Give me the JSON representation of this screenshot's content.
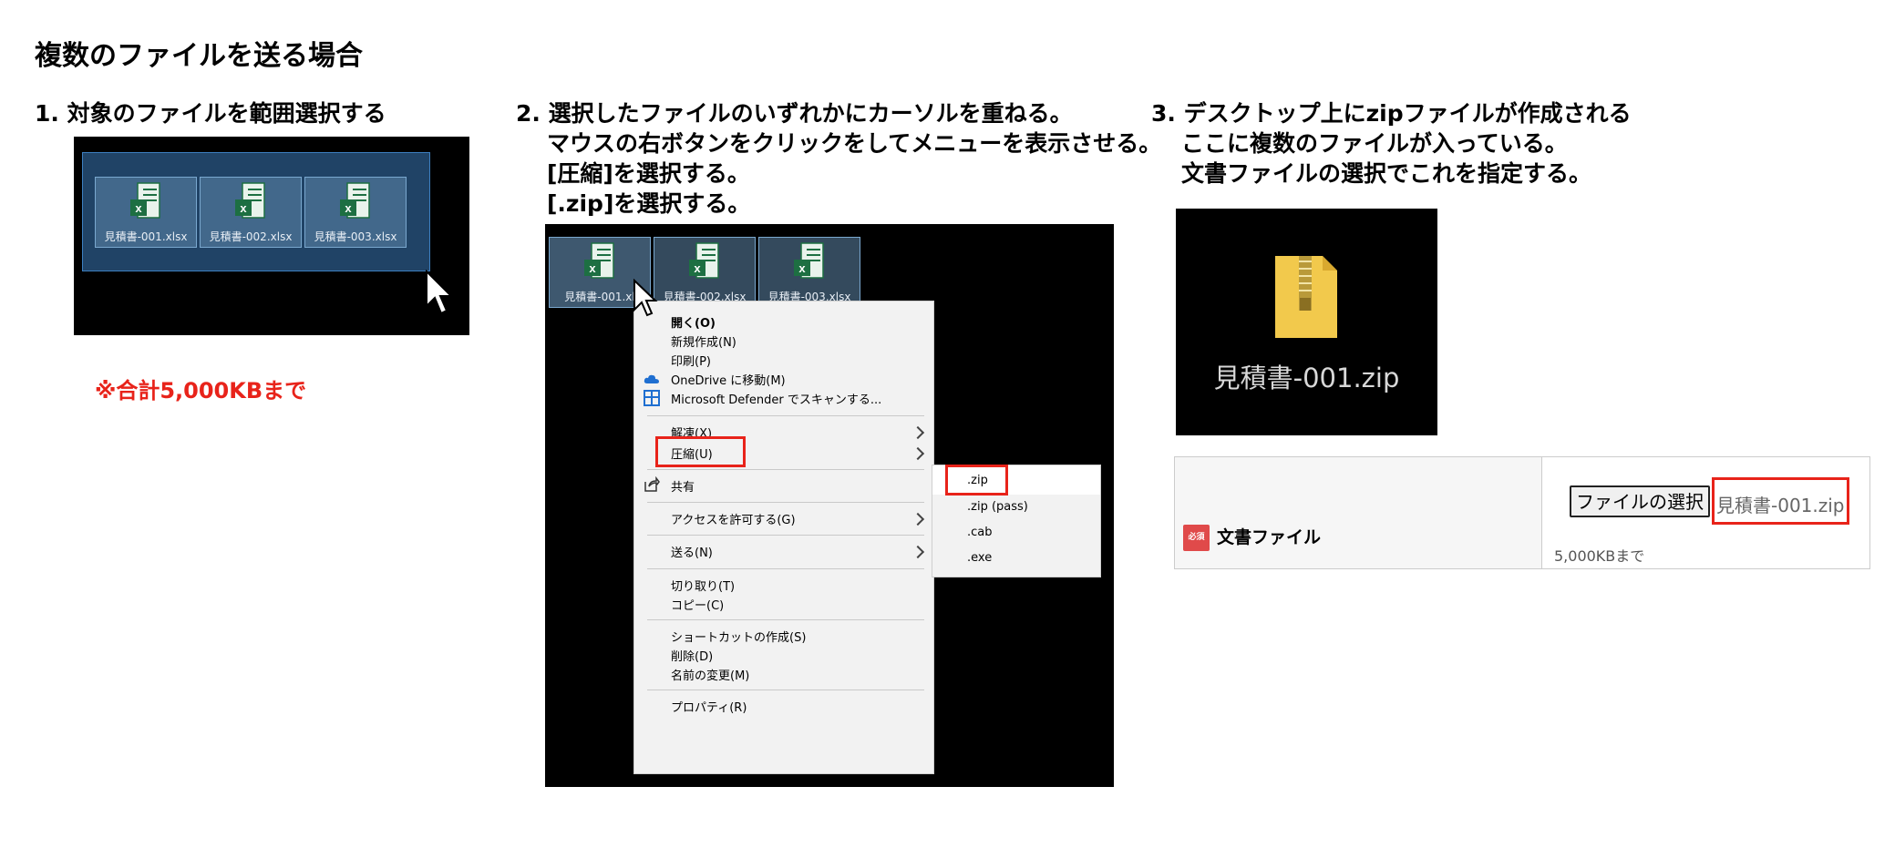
{
  "title": "複数のファイルを送る場合",
  "step1": {
    "heading": "1. 対象のファイルを範囲選択する"
  },
  "note": "※合計5,000KBまで",
  "files": [
    "見積書-001.xlsx",
    "見積書-002.xlsx",
    "見積書-003.xlsx"
  ],
  "step2": {
    "line1": "2. 選択したファイルのいずれかにカーソルを重ねる。",
    "line2": "マウスの右ボタンをクリックをしてメニューを表示させる。",
    "line3": "[圧縮]を選択する。",
    "line4": "[.zip]を選択する。"
  },
  "panel2_files": [
    "見積書-001.xl",
    "見積書-002.xlsx",
    "見積書-003.xlsx"
  ],
  "context_menu": {
    "open": "開く(O)",
    "new": "新規作成(N)",
    "print": "印刷(P)",
    "onedrive": "OneDrive に移動(M)",
    "defender": "Microsoft Defender でスキャンする...",
    "extract": "解凍(X)",
    "compress": "圧縮(U)",
    "share": "共有",
    "access": "アクセスを許可する(G)",
    "send": "送る(N)",
    "cut": "切り取り(T)",
    "copy": "コピー(C)",
    "shortcut": "ショートカットの作成(S)",
    "delete": "削除(D)",
    "rename": "名前の変更(M)",
    "properties": "プロパティ(R)"
  },
  "submenu": {
    "zip": ".zip",
    "zip_pass": ".zip (pass)",
    "cab": ".cab",
    "exe": ".exe"
  },
  "step3": {
    "line1": "3. デスクトップ上にzipファイルが作成される",
    "line2": "ここに複数のファイルが入っている。",
    "line3": "文書ファイルの選択でこれを指定する。"
  },
  "zip_file": "見積書-001.zip",
  "form": {
    "required_badge": "必須",
    "label": "文書ファイル",
    "button": "ファイルの選択",
    "chosen_file": "見積書-001.zip",
    "limit": "5,000KBまで"
  },
  "colors": {
    "red": "#e8231a",
    "excel_green": "#1d6f42",
    "zip_yellow": "#f2c94c"
  }
}
